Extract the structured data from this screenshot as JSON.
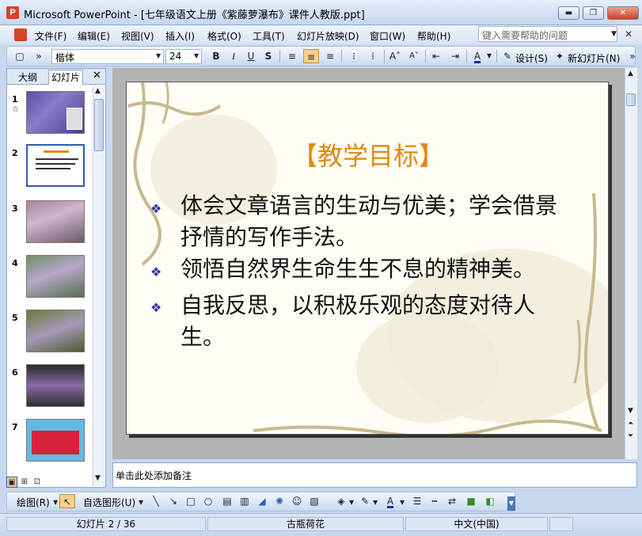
{
  "window": {
    "title": "Microsoft PowerPoint - [七年级语文上册《紫藤萝瀑布》课件人教版.ppt]",
    "minimize": "▬",
    "restore": "❐",
    "close": "✕"
  },
  "menu": {
    "items": [
      "文件(F)",
      "编辑(E)",
      "视图(V)",
      "插入(I)",
      "格式(O)",
      "工具(T)",
      "幻灯片放映(D)",
      "窗口(W)",
      "帮助(H)"
    ],
    "help_placeholder": "键入需要帮助的问题"
  },
  "toolbar": {
    "font_name": "楷体",
    "font_size": "24",
    "bold": "B",
    "italic": "I",
    "underline": "U",
    "shadow": "S",
    "design_label": "设计(S)",
    "new_slide_label": "新幻灯片(N)"
  },
  "panel": {
    "tab_outline": "大纲",
    "tab_slides": "幻灯片",
    "close": "✕",
    "thumbnails": [
      "1",
      "2",
      "3",
      "4",
      "5",
      "6",
      "7"
    ],
    "selected_index": 2
  },
  "slide": {
    "title": "【教学目标】",
    "bullet_symbol": "❖",
    "bullets": [
      "体会文章语言的生动与优美；学会借景抒情的写作手法。",
      "领悟自然界生命生生不息的精神美。",
      "自我反思，以积极乐观的态度对待人生。"
    ]
  },
  "notes": {
    "placeholder": "单击此处添加备注"
  },
  "drawing": {
    "draw_label": "绘图(R)",
    "autoshapes_label": "自选图形(U)"
  },
  "status": {
    "slide_indicator": "幻灯片 2 / 36",
    "design_template": "古瓶荷花",
    "language": "中文(中国)"
  },
  "colors": {
    "accent_title": "#e08a13",
    "bullet_color": "#3333aa",
    "chrome_blue": "#c7d8ee"
  }
}
